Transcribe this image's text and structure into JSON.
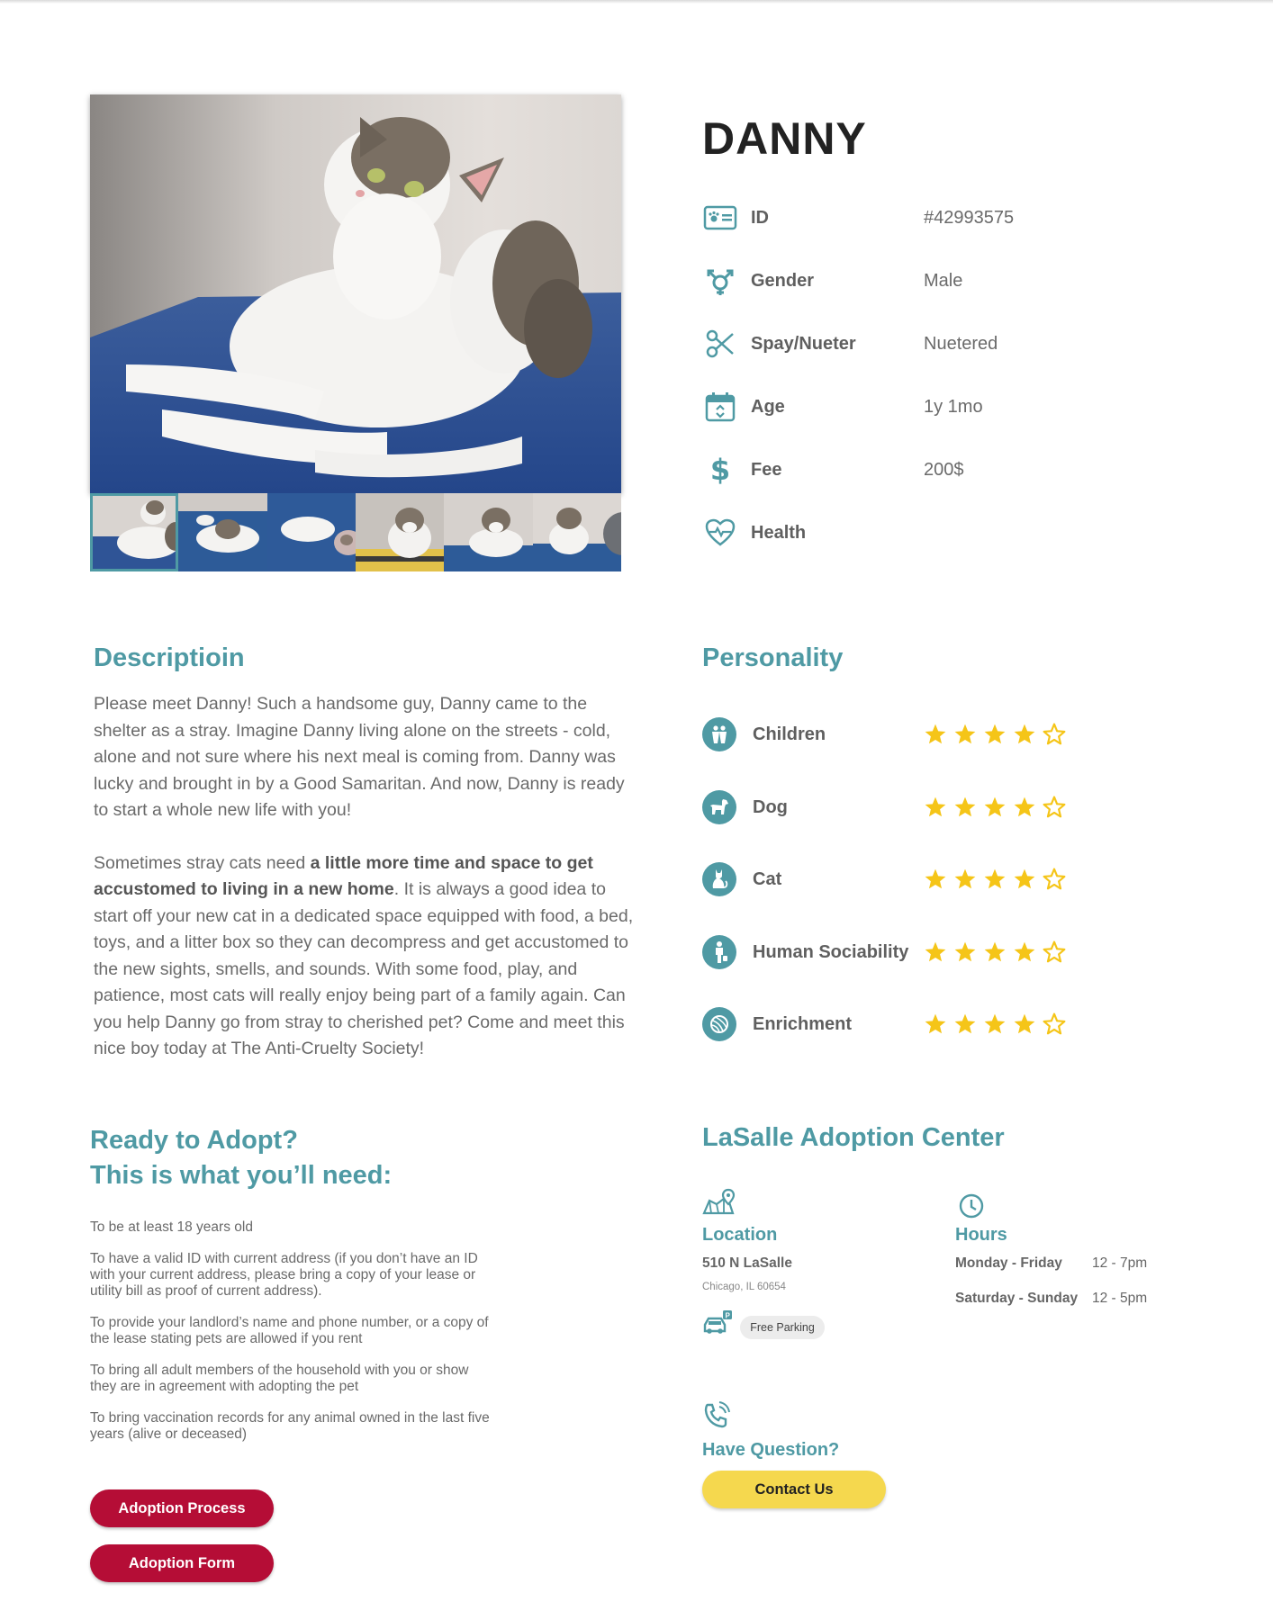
{
  "pet": {
    "name": "DANNY",
    "photo_count": 6,
    "selected_photo_index": 0
  },
  "info": [
    {
      "icon": "id-card-paw-icon",
      "label": "ID",
      "value": "#42993575"
    },
    {
      "icon": "gender-icon",
      "label": "Gender",
      "value": "Male"
    },
    {
      "icon": "scissors-icon",
      "label": "Spay/Nueter",
      "value": "Nuetered"
    },
    {
      "icon": "calendar-icon",
      "label": "Age",
      "value": "1y 1mo"
    },
    {
      "icon": "dollar-icon",
      "label": "Fee",
      "value": "200$"
    },
    {
      "icon": "heart-pulse-icon",
      "label": "Health",
      "value": ""
    }
  ],
  "description": {
    "heading": "Descriptioin",
    "para1": "Please meet Danny! Such a handsome guy, Danny came to the shelter as a stray. Imagine Danny living alone on the streets - cold, alone and not sure where his next meal is coming from. Danny was lucky and brought in by a Good Samaritan. And now, Danny is ready to start a whole new life with you!",
    "para2_start": "Sometimes stray cats need ",
    "para2_bold": "a little more time and space to get accustomed to living in a new home",
    "para2_end": ". It is always a good idea to start off your new cat in a dedicated space equipped with food, a bed, toys, and a litter box so they can decompress and get accustomed to the new sights, smells, and sounds. With some food, play, and patience, most cats will really enjoy being part of a family again. Can you help Danny go from stray to cherished pet? Come and meet this nice boy today at The Anti-Cruelty Society!"
  },
  "personality": {
    "heading": "Personality",
    "max_stars": 5,
    "star_color": "#f5c518",
    "traits": [
      {
        "icon": "children-icon",
        "label": "Children",
        "rating": 4
      },
      {
        "icon": "dog-icon",
        "label": "Dog",
        "rating": 4
      },
      {
        "icon": "cat-icon",
        "label": "Cat",
        "rating": 4
      },
      {
        "icon": "human-icon",
        "label": "Human Sociability",
        "rating": 4
      },
      {
        "icon": "yarn-ball-icon",
        "label": "Enrichment",
        "rating": 4
      }
    ]
  },
  "adopt": {
    "heading_line1": "Ready to Adopt?",
    "heading_line2": "This is what you’ll need:",
    "requirements": [
      "To be at least 18 years old",
      "To have a valid ID with current address (if you don’t have an ID with your current address, please bring a copy of your lease or utility bill as proof of current address).",
      "To provide your landlord’s name and phone number, or a copy of the lease stating pets are allowed if you rent",
      "To bring all adult members of the household with you or show they are in agreement with adopting the pet",
      "To bring vaccination records for any animal owned in the last five years (alive or deceased)"
    ],
    "process_button": "Adoption Process",
    "form_button": "Adoption Form"
  },
  "center": {
    "heading": "LaSalle Adoption Center",
    "location_heading": "Location",
    "address_line1": "510 N LaSalle",
    "address_line2": "Chicago, IL 60654",
    "parking": "Free Parking",
    "hours_heading": "Hours",
    "hours": [
      {
        "day": "Monday - Friday",
        "time": "12 - 7pm"
      },
      {
        "day": "Saturday - Sunday",
        "time": "12 - 5pm"
      }
    ],
    "question_heading": "Have Question?",
    "contact_button": "Contact Us"
  },
  "colors": {
    "accent": "#4f9aa4",
    "button_red": "#b50d36",
    "button_yellow": "#f5d84e"
  }
}
